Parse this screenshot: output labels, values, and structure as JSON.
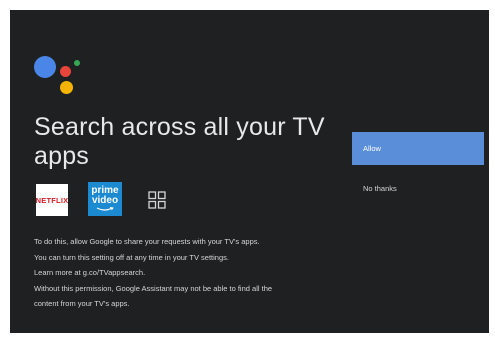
{
  "screen": {
    "title": "Search across all your TV apps",
    "apps": [
      {
        "label": "NETFLIX"
      },
      {
        "label_line1": "prime",
        "label_line2": "video"
      }
    ],
    "description": [
      "To do this, allow Google to share your requests with your TV's apps.",
      "You can turn this setting off at any time in your TV settings.",
      "Learn more at g.co/TVappsearch.",
      "Without this permission, Google Assistant may not be able to find all the",
      "content from your TV's apps."
    ]
  },
  "actions": {
    "allow_label": "Allow",
    "no_thanks_label": "No thanks"
  },
  "colors": {
    "background": "#1f2022",
    "accent": "#5b8ed9",
    "assistant_blue": "#4a86e8",
    "assistant_red": "#e8453c",
    "assistant_yellow": "#f4b400",
    "assistant_green": "#34a853",
    "netflix_red": "#d91c24",
    "prime_blue": "#1b8ad1"
  },
  "icons": [
    "google-assistant-icon",
    "netflix-icon",
    "prime-video-icon",
    "more-apps-grid-icon"
  ]
}
